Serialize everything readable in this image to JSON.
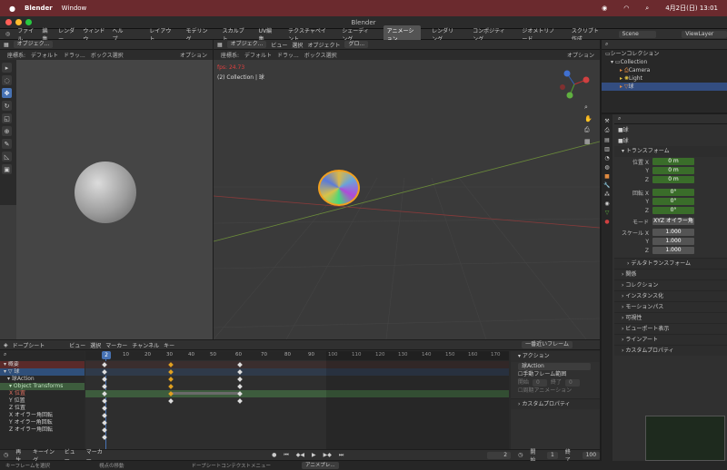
{
  "menubar": {
    "app": "Blender",
    "menu_window": "Window",
    "datetime": "4月2日(日) 13:01"
  },
  "window_title": "Blender",
  "topbar": {
    "menus": [
      "ファイル",
      "編集",
      "レンダー",
      "ウィンドウ",
      "ヘルプ"
    ],
    "workspaces": [
      "レイアウト",
      "モデリング",
      "スカルプト",
      "UV編集",
      "テクスチャペイント",
      "シェーディング",
      "アニメーション",
      "レンダリング",
      "コンポジティング",
      "ジオメトリノード",
      "スクリプト作成"
    ],
    "active_workspace": "アニメーション",
    "scene": "Scene",
    "viewlayer": "ViewLayer"
  },
  "viewport_left": {
    "mode": "オブジェク...",
    "coords": "座標系:",
    "default": "デフォルト",
    "drag": "ドラッ...",
    "box": "ボックス選択",
    "options": "オプション"
  },
  "viewport_main": {
    "mode": "オブジェク...",
    "menu": [
      "ビュー",
      "選択",
      "オブジェクト"
    ],
    "global": "グロ...",
    "coords": "座標系:",
    "default": "デフォルト",
    "drag": "ドラッ...",
    "box": "ボックス選択",
    "options": "オプション",
    "fps": "fps: 24.73",
    "collection": "(2) Collection | 球"
  },
  "outliner": {
    "scene_collection": "シーンコレクション",
    "collection": "Collection",
    "items": [
      "Camera",
      "Light",
      "球"
    ]
  },
  "properties": {
    "object_name": "球",
    "data_name": "球",
    "transform_title": "トランスフォーム",
    "location_label": "位置 X",
    "location": [
      "0 m",
      "0 m",
      "0 m"
    ],
    "rotation_label": "回転 X",
    "rotation": [
      "0°",
      "0°",
      "0°"
    ],
    "axis_y": "Y",
    "axis_z": "Z",
    "mode_label": "モード",
    "mode_value": "XYZ オイラー角",
    "scale_label": "スケール X",
    "scale": [
      "1.000",
      "1.000",
      "1.000"
    ],
    "delta": "デルタトランスフォーム",
    "sections": [
      "関係",
      "コレクション",
      "インスタンス化",
      "モーションパス",
      "可視性",
      "ビューポート表示",
      "ラインアート",
      "カスタムプロパティ"
    ]
  },
  "dopesheet": {
    "editor": "ドープシート",
    "menu": [
      "ビュー",
      "選択",
      "マーカー",
      "チャンネル",
      "キー"
    ],
    "interp": "一番近いフレーム",
    "current_frame": "2",
    "ticks": [
      "0",
      "10",
      "20",
      "30",
      "40",
      "50",
      "60",
      "70",
      "80",
      "90",
      "100",
      "110",
      "120",
      "130",
      "140",
      "150",
      "160",
      "170"
    ],
    "channels": [
      "概要",
      "球",
      "球Action",
      "Object Transforms",
      "X 位置",
      "Y 位置",
      "Z 位置",
      "X オイラー角回転",
      "Y オイラー角回転",
      "Z オイラー角回転"
    ],
    "action_panel": {
      "title": "アクション",
      "action_name": "球Action",
      "manual_range": "手動フレーム範囲",
      "start": "開始",
      "end": "終了",
      "start_value": "0",
      "end_value": "0",
      "cyclic": "周期アニメーション",
      "custom_props": "カスタムプロパティ"
    }
  },
  "timeline": {
    "play": "再生",
    "keying": "キーイング",
    "view": "ビュー",
    "marker": "マーカー",
    "frame": "2",
    "start_label": "開始",
    "start": "1",
    "end_label": "終了",
    "end": "100"
  },
  "status": {
    "items": [
      "キーフレームを選択",
      "視点の移動",
      "ドープシートコンテクストメニュー",
      "アニメプレ..."
    ]
  }
}
